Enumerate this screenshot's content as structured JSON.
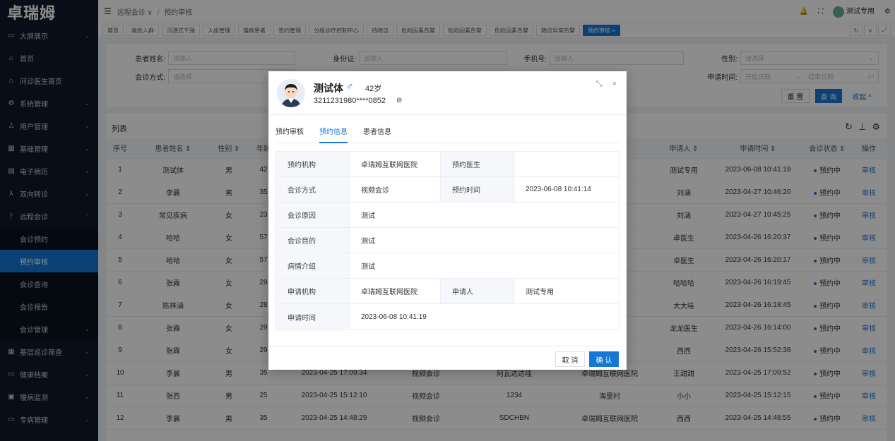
{
  "app": {
    "logo": "卓瑞姆"
  },
  "sidebar": {
    "items": [
      {
        "icon": "▭",
        "label": "大屏展示",
        "chev": "⌄"
      },
      {
        "icon": "⌂",
        "label": "首页",
        "chev": ""
      },
      {
        "icon": "⌂",
        "label": "问诊医生首页",
        "chev": ""
      },
      {
        "icon": "⚙",
        "label": "系统管理",
        "chev": "⌄"
      },
      {
        "icon": "♙",
        "label": "用户管理",
        "chev": "⌄"
      },
      {
        "icon": "▦",
        "label": "基础管理",
        "chev": "⌄"
      },
      {
        "icon": "▤",
        "label": "电子病历",
        "chev": "⌄"
      },
      {
        "icon": "⅄",
        "label": "双向转诊",
        "chev": "⌄"
      },
      {
        "icon": "ᚹ",
        "label": "远程会诊",
        "chev": "⌃"
      }
    ],
    "sub_items": [
      {
        "label": "会诊预约",
        "chev": ""
      },
      {
        "label": "预约审核",
        "chev": ""
      },
      {
        "label": "会诊查询",
        "chev": ""
      },
      {
        "label": "会诊报告",
        "chev": ""
      },
      {
        "label": "会诊管理",
        "chev": "⌄"
      }
    ],
    "bottom_items": [
      {
        "icon": "▦",
        "label": "基层巡诊筛查",
        "chev": "⌄"
      },
      {
        "icon": "▭",
        "label": "健康档案",
        "chev": "⌄"
      },
      {
        "icon": "▣",
        "label": "慢病监测",
        "chev": "⌄"
      },
      {
        "icon": "▭",
        "label": "专病管理",
        "chev": "⌄"
      }
    ]
  },
  "header": {
    "breadcrumb": [
      "远程会诊 ∨",
      "预约审核"
    ],
    "bell": "🔔",
    "fullscreen": "⛶",
    "user": "测试专用",
    "settings": "⚙"
  },
  "tabs": [
    "首页",
    "高危人群",
    "沉浸式干预",
    "入组管理",
    "慢病患者",
    "签约管理",
    "分级诊疗控制中心",
    "待随访",
    "危险因素告警",
    "危险因素告警",
    "危险因素告警",
    "随访异常告警",
    "预约审核 ×"
  ],
  "tabs_ctrl": [
    "↻",
    "∨",
    "⤢"
  ],
  "search": {
    "name_label": "患者姓名:",
    "name_ph": "请输入",
    "id_label": "身份证:",
    "id_ph": "请输入",
    "phone_label": "手机号:",
    "phone_ph": "请输入",
    "gender_label": "性别:",
    "gender_ph": "请选择",
    "method_label": "会诊方式:",
    "method_ph": "请选择",
    "time_label": "申请时间:",
    "start_ph": "开始日期",
    "end_ph": "结束日期",
    "arrow": "→",
    "reset": "重 置",
    "query": "查 询",
    "collapse": "收起 ^"
  },
  "list": {
    "title": "列表",
    "tools": [
      "↻",
      "⊥",
      "⚙"
    ],
    "columns": [
      "序号",
      "患者姓名 ⇕",
      "性别 ⇕",
      "年龄",
      "",
      "",
      "",
      "",
      "申请人 ⇕",
      "申请时间 ⇕",
      "会诊状态 ⇕",
      "操作"
    ],
    "rows": [
      {
        "no": "1",
        "name": "测试体",
        "sex": "男",
        "age": "42",
        "time1": "",
        "method": "",
        "org": "",
        "hosp": "",
        "applicant": "测试专用",
        "apply_time": "2023-06-08 10:41:19",
        "status": "预约中",
        "op": "审核"
      },
      {
        "no": "2",
        "name": "李晨",
        "sex": "男",
        "age": "35",
        "time1": "",
        "method": "",
        "org": "",
        "hosp": "",
        "applicant": "刘涵",
        "apply_time": "2023-04-27 10:46:20",
        "status": "预约中",
        "op": "审核"
      },
      {
        "no": "3",
        "name": "常见疾病",
        "sex": "女",
        "age": "23",
        "time1": "",
        "method": "",
        "org": "",
        "hosp": "",
        "applicant": "刘涵",
        "apply_time": "2023-04-27 10:45:25",
        "status": "预约中",
        "op": "审核"
      },
      {
        "no": "4",
        "name": "哈哈",
        "sex": "女",
        "age": "57",
        "time1": "",
        "method": "",
        "org": "",
        "hosp": "",
        "applicant": "卓医生",
        "apply_time": "2023-04-26 16:20:37",
        "status": "预约中",
        "op": "审核"
      },
      {
        "no": "5",
        "name": "哈哈",
        "sex": "女",
        "age": "57",
        "time1": "",
        "method": "",
        "org": "",
        "hosp": "",
        "applicant": "卓医生",
        "apply_time": "2023-04-26 16:20:17",
        "status": "预约中",
        "op": "审核"
      },
      {
        "no": "6",
        "name": "张霖",
        "sex": "女",
        "age": "29",
        "time1": "",
        "method": "",
        "org": "",
        "hosp": "",
        "applicant": "哈哈哈",
        "apply_time": "2023-04-26 16:19:45",
        "status": "预约中",
        "op": "审核"
      },
      {
        "no": "7",
        "name": "陈梓涵",
        "sex": "女",
        "age": "28",
        "time1": "",
        "method": "",
        "org": "",
        "hosp": "",
        "applicant": "大大哇",
        "apply_time": "2023-04-26 16:18:45",
        "status": "预约中",
        "op": "审核"
      },
      {
        "no": "8",
        "name": "张霖",
        "sex": "女",
        "age": "29",
        "time1": "",
        "method": "",
        "org": "",
        "hosp": "",
        "applicant": "龙龙医生",
        "apply_time": "2023-04-26 16:14:00",
        "status": "预约中",
        "op": "审核"
      },
      {
        "no": "9",
        "name": "张霖",
        "sex": "女",
        "age": "29",
        "time1": "",
        "method": "",
        "org": "",
        "hosp": "",
        "applicant": "西西",
        "apply_time": "2023-04-26 15:52:38",
        "status": "预约中",
        "op": "审核"
      },
      {
        "no": "10",
        "name": "李晨",
        "sex": "男",
        "age": "35",
        "time1": "2023-04-25 17:09:34",
        "method": "视频会诊",
        "org": "阿瓦达达哇",
        "hosp": "卓瑞姆互联网医院",
        "applicant": "王甜甜",
        "apply_time": "2023-04-25 17:09:52",
        "status": "预约中",
        "op": "审核"
      },
      {
        "no": "11",
        "name": "张西",
        "sex": "男",
        "age": "25",
        "time1": "2023-04-25 15:12:10",
        "method": "视频会诊",
        "org": "1234",
        "hosp": "海里村",
        "applicant": "小小",
        "apply_time": "2023-04-25 15:12:15",
        "status": "预约中",
        "op": "审核"
      },
      {
        "no": "12",
        "name": "李晨",
        "sex": "男",
        "age": "35",
        "time1": "2023-04-25 14:48:29",
        "method": "视频会诊",
        "org": "SDCHBN",
        "hosp": "卓瑞姆互联网医院",
        "applicant": "西西",
        "apply_time": "2023-04-25 14:48:55",
        "status": "预约中",
        "op": "审核"
      }
    ]
  },
  "modal": {
    "name": "测试体",
    "gender_icon": "♂",
    "age": "42岁",
    "id_masked": "3211231980****0852",
    "eye_icon": "⊘",
    "ctrl_expand": "⤡",
    "ctrl_close": "×",
    "tabs": [
      "预约审核",
      "预约信息",
      "患者信息"
    ],
    "details": {
      "org_k": "预约机构",
      "org_v": "卓瑞姆互联网医院",
      "doc_k": "预约医生",
      "doc_v": "",
      "method_k": "会诊方式",
      "method_v": "视频会诊",
      "time_k": "预约时间",
      "time_v": "2023-06-08 10:41:14",
      "reason_k": "会诊原因",
      "reason_v": "测试",
      "purpose_k": "会诊目的",
      "purpose_v": "测试",
      "cond_k": "病情介绍",
      "cond_v": "测试",
      "applyorg_k": "申请机构",
      "applyorg_v": "卓瑞姆互联网医院",
      "applicant_k": "申请人",
      "applicant_v": "测试专用",
      "applytime_k": "申请时间",
      "applytime_v": "2023-06-08 10:41:19"
    },
    "cancel": "取 消",
    "confirm": "确 认"
  },
  "colors": {
    "primary": "#1677d6",
    "sidebar_bg": "#0f1a2b"
  }
}
